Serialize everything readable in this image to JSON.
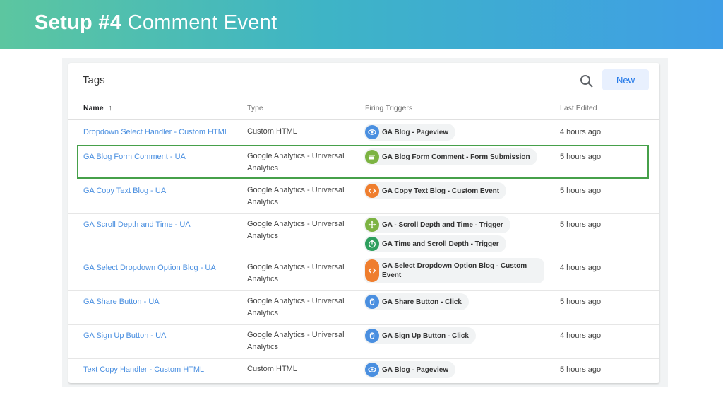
{
  "banner": {
    "title_bold": "Setup #4",
    "title_rest": "Comment Event"
  },
  "panel": {
    "title": "Tags",
    "new_label": "New",
    "columns": {
      "name": "Name",
      "sort_arrow": "↑",
      "type": "Type",
      "triggers": "Firing Triggers",
      "edited": "Last Edited"
    }
  },
  "colors": {
    "blue": "#4a8fe0",
    "orange": "#ef7e2e",
    "green": "#7cb342",
    "teal_green": "#2e9f5e",
    "highlight": "#46a04a"
  },
  "rows": [
    {
      "name": "Dropdown Select Handler - Custom HTML",
      "type": "Custom HTML",
      "triggers": [
        {
          "label": "GA Blog - Pageview",
          "icon": "eye-icon"
        }
      ],
      "edited": "4 hours ago"
    },
    {
      "name": "GA Blog Form Comment - UA",
      "type": "Google Analytics - Universal Analytics",
      "triggers": [
        {
          "label": "GA Blog Form Comment - Form Submission",
          "icon": "form-icon"
        }
      ],
      "edited": "5 hours ago"
    },
    {
      "name": "GA Copy Text Blog - UA",
      "type": "Google Analytics - Universal Analytics",
      "triggers": [
        {
          "label": "GA Copy Text Blog - Custom Event",
          "icon": "code-icon"
        }
      ],
      "edited": "5 hours ago"
    },
    {
      "name": "GA Scroll Depth and Time - UA",
      "type": "Google Analytics - Universal Analytics",
      "triggers": [
        {
          "label": "GA - Scroll Depth and Time - Trigger",
          "icon": "move-icon"
        },
        {
          "label": "GA Time and Scroll Depth - Trigger",
          "icon": "timer-icon"
        }
      ],
      "edited": "5 hours ago"
    },
    {
      "name": "GA Select Dropdown Option Blog - UA",
      "type": "Google Analytics - Universal Analytics",
      "triggers": [
        {
          "label": "GA Select Dropdown Option Blog - Custom Event",
          "icon": "code-icon"
        }
      ],
      "edited": "4 hours ago"
    },
    {
      "name": "GA Share Button - UA",
      "type": "Google Analytics - Universal Analytics",
      "triggers": [
        {
          "label": "GA Share Button - Click",
          "icon": "click-icon"
        }
      ],
      "edited": "5 hours ago"
    },
    {
      "name": "GA Sign Up Button - UA",
      "type": "Google Analytics - Universal Analytics",
      "triggers": [
        {
          "label": "GA Sign Up Button - Click",
          "icon": "click-icon"
        }
      ],
      "edited": "4 hours ago"
    },
    {
      "name": "Text Copy Handler - Custom HTML",
      "type": "Custom HTML",
      "triggers": [
        {
          "label": "GA Blog - Pageview",
          "icon": "eye-icon"
        }
      ],
      "edited": "5 hours ago"
    }
  ]
}
